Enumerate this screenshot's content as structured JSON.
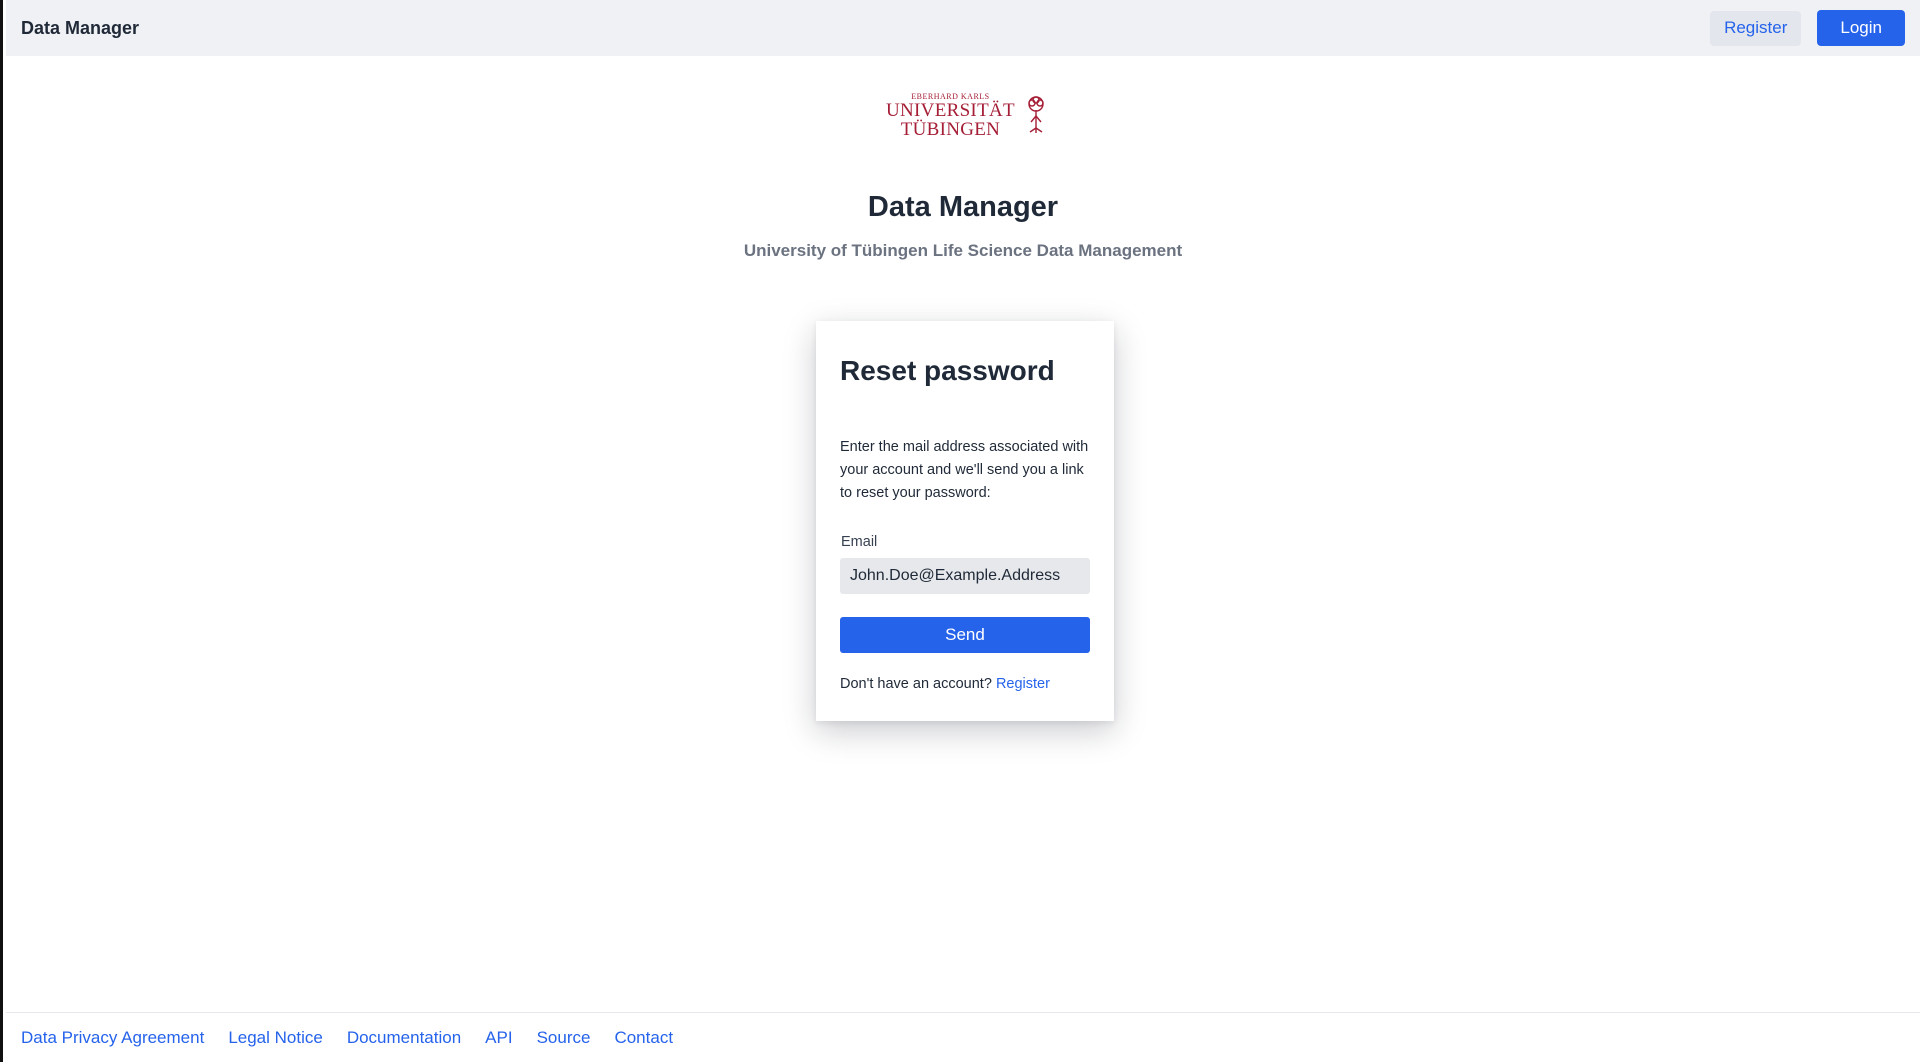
{
  "header": {
    "brand": "Data Manager",
    "register_label": "Register",
    "login_label": "Login"
  },
  "logo": {
    "line_small": "EBERHARD KARLS",
    "line_1": "UNIVERSITÄT",
    "line_2": "TÜBINGEN",
    "icon": "university-tree-emblem-icon"
  },
  "main": {
    "title": "Data Manager",
    "subtitle": "University of Tübingen Life Science Data Management"
  },
  "reset_card": {
    "heading": "Reset password",
    "description": "Enter the mail address associated with your account and we'll send you a link to reset your password:",
    "email_label": "Email",
    "email_value": "John.Doe@Example.Address",
    "send_label": "Send",
    "no_account_text": "Don't have an account?",
    "register_link": "Register"
  },
  "footer": {
    "links": [
      "Data Privacy Agreement",
      "Legal Notice",
      "Documentation",
      "API",
      "Source",
      "Contact"
    ]
  },
  "colors": {
    "accent": "#2563eb",
    "topbar_bg": "#f0f1f4",
    "brand_red": "#a51e36"
  }
}
